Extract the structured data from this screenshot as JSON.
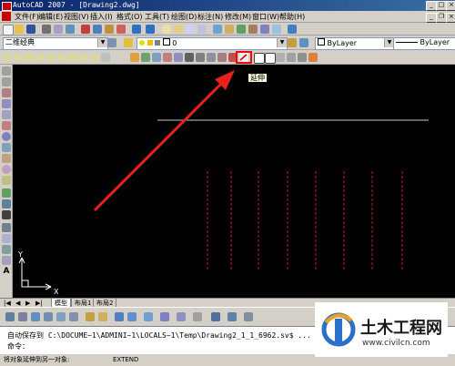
{
  "window": {
    "title": "AutoCAD 2007 - [Drawing2.dwg]"
  },
  "menu": {
    "items": [
      "文件(F)",
      "编辑(E)",
      "视图(V)",
      "插入(I)",
      "格式(O)",
      "工具(T)",
      "绘图(D)",
      "标注(N)",
      "修改(M)",
      "窗口(W)",
      "帮助(H)"
    ]
  },
  "toolbar_props": {
    "workspace": "二维经典",
    "layer": "0",
    "color": "ByLayer",
    "linetype": "ByLayer"
  },
  "tooltip": {
    "text": "延伸"
  },
  "tabs": [
    "模型",
    "布局1",
    "布局2"
  ],
  "command_lines": [
    "自动保存到 C:\\DOCUME~1\\ADMINI~1\\LOCALS~1\\Temp\\Drawing2_1_1_6962.sv$ ...",
    "命令："
  ],
  "status": {
    "prompt": "将对象延伸到另一对象:",
    "command": "EXTEND"
  },
  "ucs": {
    "x_label": "X",
    "y_label": "Y"
  },
  "watermark": {
    "brand": "土木工程网",
    "url": "www.civilcn.com"
  },
  "colors": {
    "highlight_box": "#ff0000",
    "arrow": "#e8221a",
    "cad_lines": "#c02020",
    "boundary_line": "#c8c8c8"
  },
  "icons": {
    "extend_tool": "extend-icon",
    "modify_tools": [
      "erase-icon",
      "copy-icon",
      "mirror-icon",
      "offset-icon",
      "array-icon",
      "move-icon",
      "rotate-icon",
      "scale-icon",
      "stretch-icon",
      "trim-icon",
      "extend-icon",
      "break-at-point-icon",
      "break-icon",
      "join-icon",
      "chamfer-icon",
      "fillet-icon",
      "explode-icon"
    ]
  }
}
